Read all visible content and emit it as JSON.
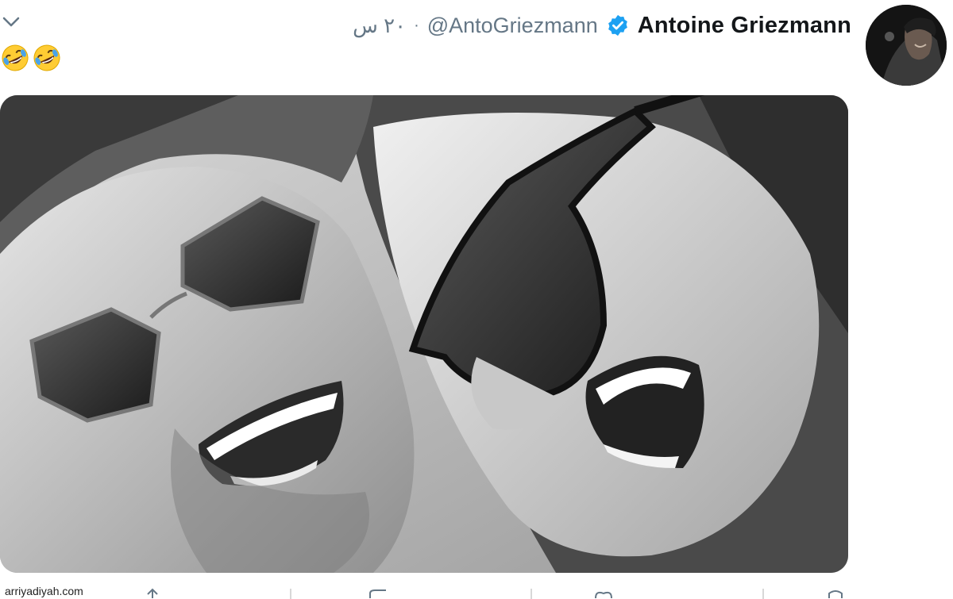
{
  "tweet": {
    "author_name": "Antoine Griezmann",
    "handle": "@AntoGriezmann",
    "separator": "·",
    "time": "٢٠ س",
    "text_emojis": [
      "rolling-on-floor-laughing-emoji",
      "rolling-on-floor-laughing-emoji"
    ],
    "verified_color": "#1da1f2",
    "media_description_icon": "photo"
  },
  "watermark": {
    "text": "arriyadiyah.com"
  },
  "actions": [
    {
      "name": "share-icon"
    },
    {
      "name": "like-icon"
    },
    {
      "name": "retweet-icon"
    },
    {
      "name": "reply-icon"
    }
  ],
  "colors": {
    "name": "#14171a",
    "secondary": "#657786",
    "accent": "#1da1f2"
  }
}
